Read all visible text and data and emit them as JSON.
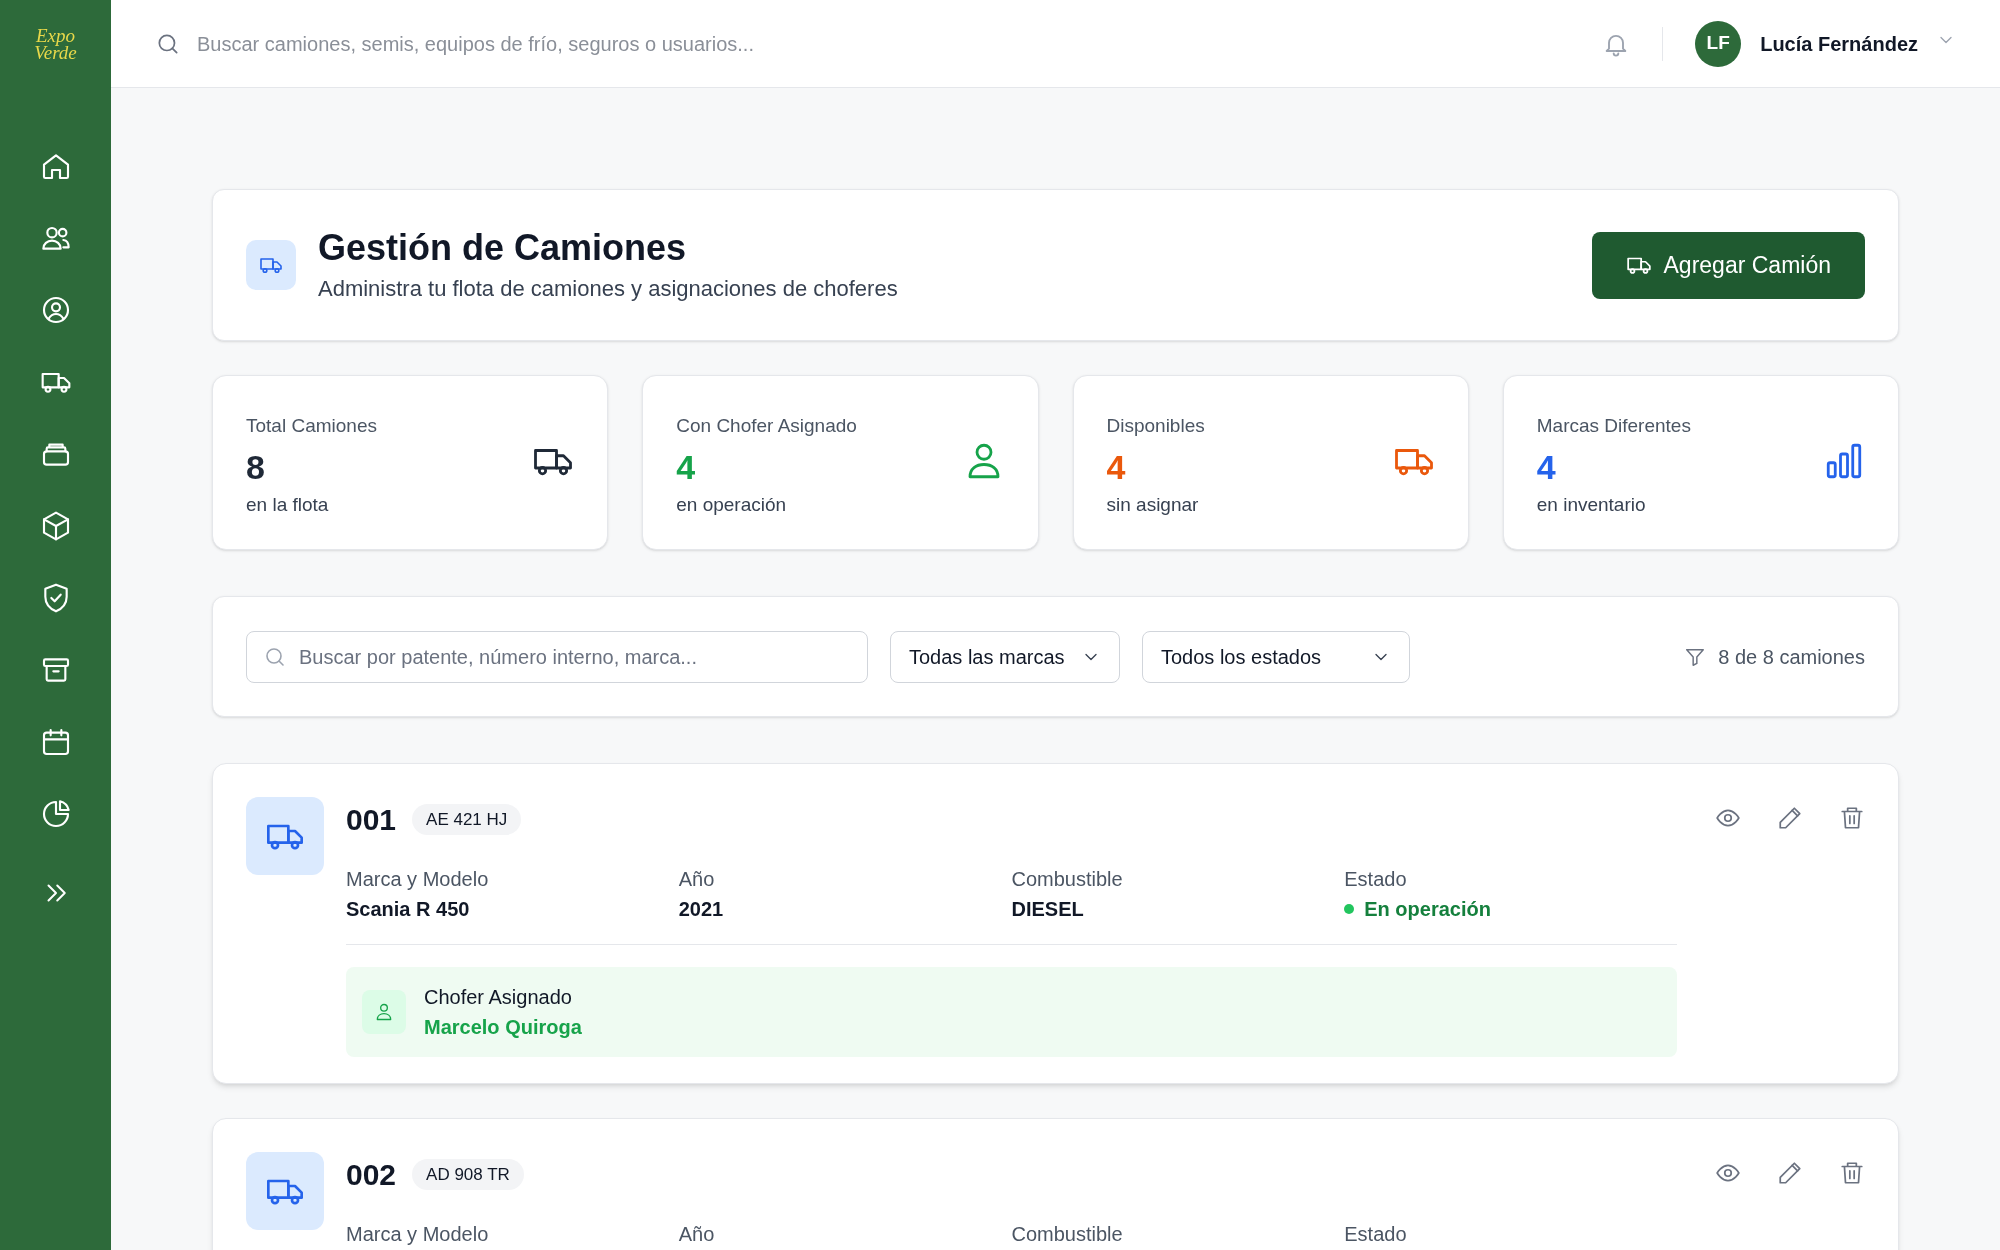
{
  "logo": {
    "line_1": "Expo",
    "line_2": "Verde"
  },
  "header": {
    "search": {
      "placeholder": "Buscar camiones, semis, equipos de frío, seguros o usuarios..."
    },
    "user": {
      "initials": "LF",
      "name": "Lucía Fernández"
    }
  },
  "page_header": {
    "title": "Gestión de Camiones",
    "subtitle": "Administra tu flota de camiones y asignaciones de choferes",
    "button": "Agregar Camión"
  },
  "stats": [
    {
      "label": "Total Camiones",
      "value": "8",
      "caption": "en la flota",
      "color": "#1f2937",
      "kind": "truck"
    },
    {
      "label": "Con Chofer Asignado",
      "value": "4",
      "caption": "en operación",
      "color": "#16a34a",
      "kind": "person"
    },
    {
      "label": "Disponibles",
      "value": "4",
      "caption": "sin asignar",
      "color": "#ea580c",
      "kind": "truck"
    },
    {
      "label": "Marcas Diferentes",
      "value": "4",
      "caption": "en inventario",
      "color": "#2563eb",
      "kind": "bars"
    }
  ],
  "filters": {
    "search": {
      "placeholder": "Buscar por patente, número interno, marca..."
    },
    "brand_select": "Todas las marcas",
    "status_select": "Todos los estados",
    "count": "8 de 8 camiones"
  },
  "trucks": [
    {
      "number": "001",
      "plate": "AE 421 HJ",
      "fields": [
        {
          "label": "Marca y Modelo",
          "value": "Scania R 450"
        },
        {
          "label": "Año",
          "value": "2021"
        },
        {
          "label": "Combustible",
          "value": "DIESEL"
        }
      ],
      "status": {
        "label": "Estado",
        "value": "En operación",
        "color": "#22c55e"
      },
      "driver": {
        "label": "Chofer Asignado",
        "name": "Marcelo Quiroga"
      }
    },
    {
      "number": "002",
      "plate": "AD 908 TR",
      "fields": [
        {
          "label": "Marca y Modelo"
        },
        {
          "label": "Año"
        },
        {
          "label": "Combustible"
        }
      ],
      "status": {
        "label": "Estado"
      }
    }
  ]
}
